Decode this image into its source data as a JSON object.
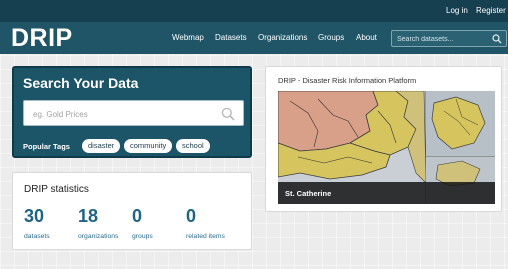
{
  "topbar": {
    "login": "Log in",
    "register": "Register"
  },
  "header": {
    "logo": "DRIP",
    "nav": [
      "Webmap",
      "Datasets",
      "Organizations",
      "Groups",
      "About"
    ],
    "search_placeholder": "Search datasets..."
  },
  "search_panel": {
    "title": "Search Your Data",
    "placeholder": "eg. Gold Prices",
    "tags_label": "Popular Tags",
    "tags": [
      "disaster",
      "community",
      "school"
    ]
  },
  "stats": {
    "title": "DRIP statistics",
    "items": [
      {
        "value": "30",
        "label": "datasets"
      },
      {
        "value": "18",
        "label": "organizations"
      },
      {
        "value": "0",
        "label": "groups"
      },
      {
        "value": "0",
        "label": "related items"
      }
    ]
  },
  "platform": {
    "title": "DRIP - Disaster Risk Information Platform",
    "map_caption": "St. Catherine"
  },
  "colors": {
    "topbar": "#163f4f",
    "header": "#1f5567",
    "panel": "#1c5568",
    "stat_value": "#1e6585",
    "map_risk_high": "#d9a089",
    "map_risk_medium": "#d6c45f"
  }
}
